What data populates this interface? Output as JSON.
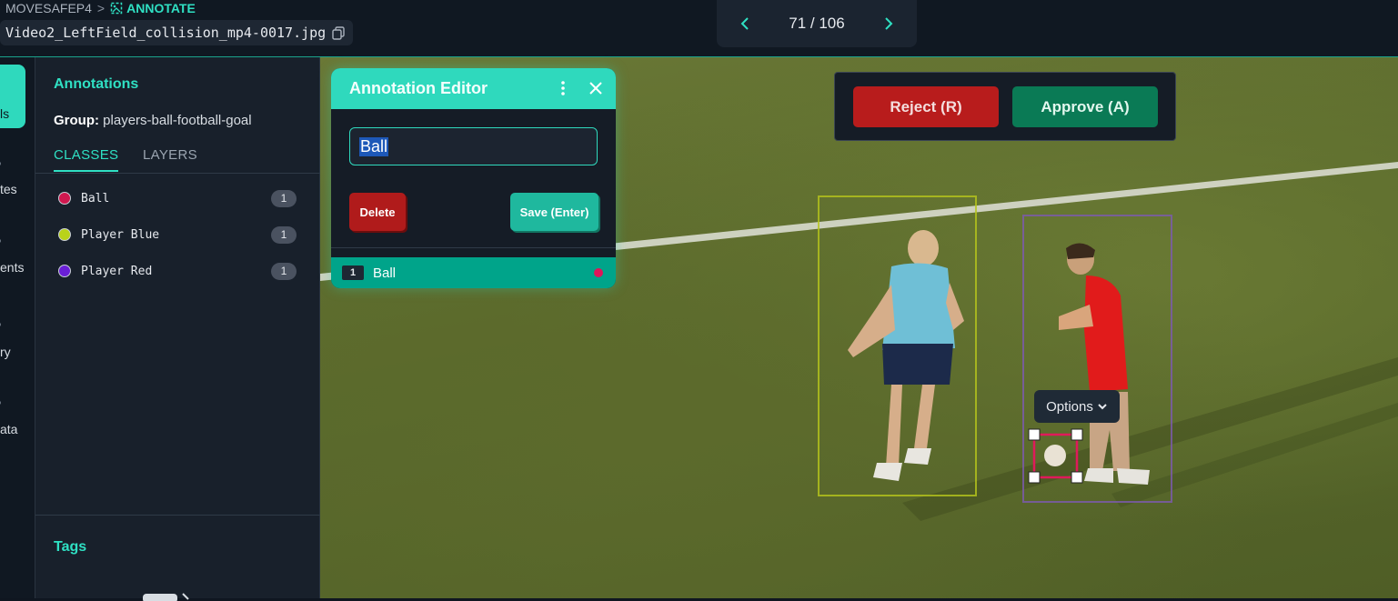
{
  "header": {
    "breadcrumb_project": "MOVESAFEP4",
    "breadcrumb_separator": ">",
    "breadcrumb_current": "ANNOTATE",
    "filename": "Video2_LeftField_collision_mp4-0017.jpg",
    "pager_count": "71 / 106"
  },
  "rail": {
    "items": [
      "ls",
      "tes",
      "ents",
      "ry",
      "ata"
    ]
  },
  "panel": {
    "title": "Annotations",
    "group_label": "Group:",
    "group_value": "players-ball-football-goal",
    "tabs": [
      "CLASSES",
      "LAYERS"
    ],
    "classes": [
      {
        "name": "Ball",
        "count": "1",
        "color": "#d0184f"
      },
      {
        "name": "Player Blue",
        "count": "1",
        "color": "#b9d21a"
      },
      {
        "name": "Player Red",
        "count": "1",
        "color": "#6a1fd6"
      }
    ],
    "tags_title": "Tags"
  },
  "editor": {
    "title": "Annotation Editor",
    "input_value": "Ball",
    "delete_label": "Delete",
    "save_label": "Save (Enter)",
    "row_num": "1",
    "row_name": "Ball"
  },
  "review": {
    "reject_label": "Reject (R)",
    "approve_label": "Approve (A)"
  },
  "options_label": "Options"
}
